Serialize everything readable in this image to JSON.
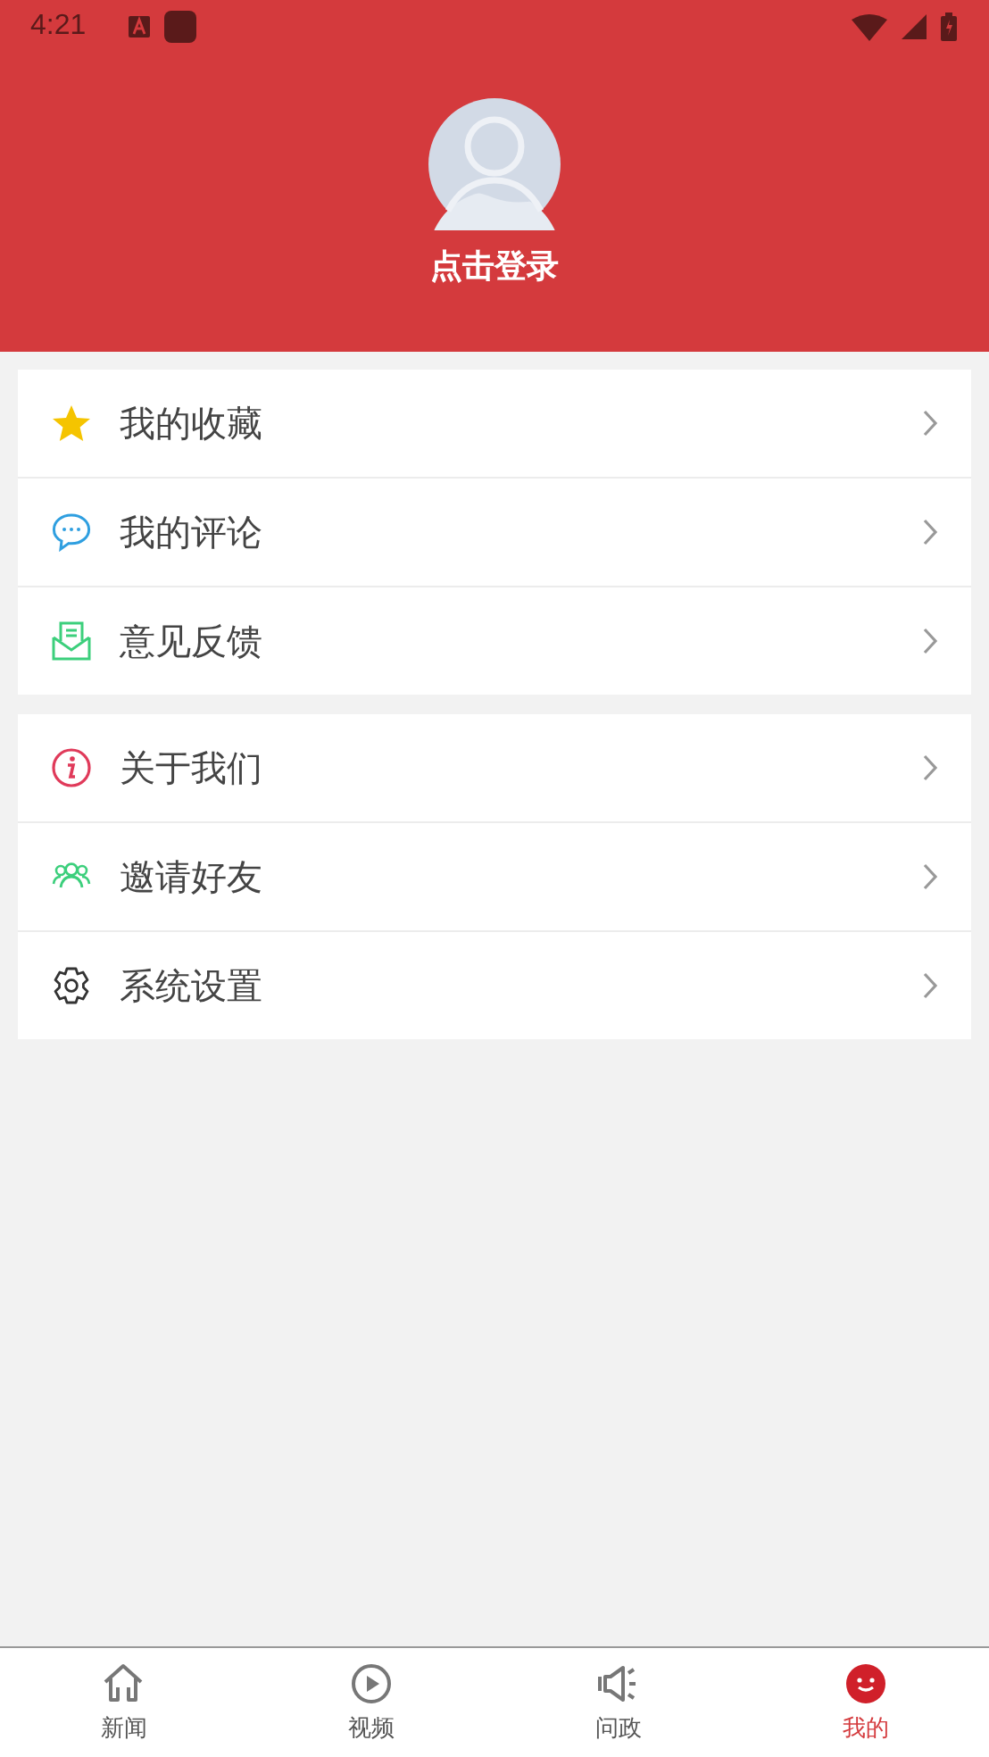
{
  "status_bar": {
    "time": "4:21"
  },
  "header": {
    "login_label": "点击登录"
  },
  "menu_groups": [
    {
      "items": [
        {
          "label": "我的收藏",
          "kind": "star"
        },
        {
          "label": "我的评论",
          "kind": "comment"
        },
        {
          "label": "意见反馈",
          "kind": "mail"
        }
      ]
    },
    {
      "items": [
        {
          "label": "关于我们",
          "kind": "info"
        },
        {
          "label": "邀请好友",
          "kind": "people"
        },
        {
          "label": "系统设置",
          "kind": "gear"
        }
      ]
    }
  ],
  "tab_bar": [
    {
      "label": "新闻",
      "kind": "home",
      "selected": false
    },
    {
      "label": "视频",
      "kind": "play",
      "selected": false
    },
    {
      "label": "问政",
      "kind": "speaker",
      "selected": false
    },
    {
      "label": "我的",
      "kind": "face",
      "selected": true
    }
  ]
}
